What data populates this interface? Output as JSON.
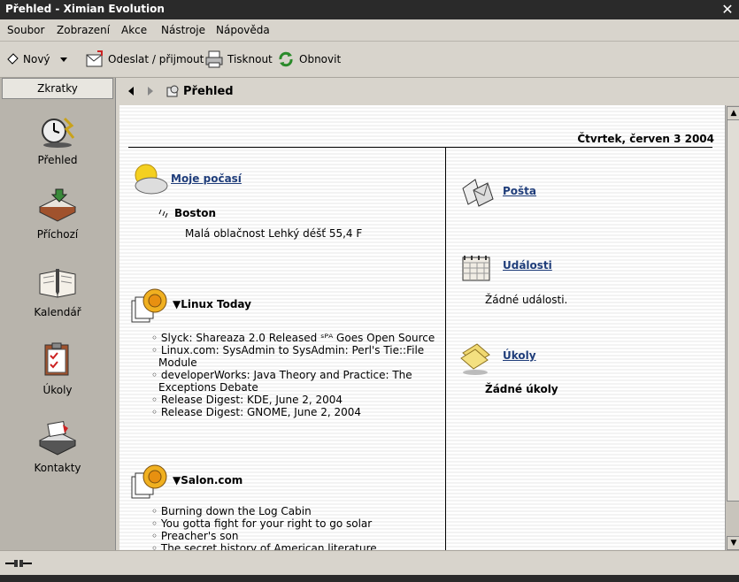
{
  "window": {
    "title": "Přehled - Ximian Evolution"
  },
  "menubar": [
    "Soubor",
    "Zobrazení",
    "Akce",
    "Nástroje",
    "Nápověda"
  ],
  "toolbar": {
    "new": "Nový",
    "send_receive": "Odeslat / přijmout",
    "print": "Tisknout",
    "refresh": "Obnovit"
  },
  "sidebar": {
    "header": "Zkratky",
    "items": [
      {
        "label": "Přehled",
        "icon": "summary-clock-icon"
      },
      {
        "label": "Příchozí",
        "icon": "inbox-tray-icon"
      },
      {
        "label": "Kalendář",
        "icon": "calendar-book-icon"
      },
      {
        "label": "Úkoly",
        "icon": "clipboard-tasks-icon"
      },
      {
        "label": "Kontakty",
        "icon": "contacts-cards-icon"
      }
    ]
  },
  "content": {
    "title": "Přehled",
    "date": "Čtvrtek, červen 3 2004",
    "weather": {
      "title": "Moje počasí",
      "city": "Boston",
      "city_suffix": ":",
      "conditions": "Malá oblačnost Lehký déšť 55,4 F"
    },
    "feeds": [
      {
        "title": "Linux Today",
        "items": [
          "Slyck: Shareaza 2.0 Released ˢᴾᴬ Goes Open Source",
          "Linux.com: SysAdmin to SysAdmin: Perl's Tie::File Module",
          "developerWorks: Java Theory and Practice: The Exceptions Debate",
          "Release Digest: KDE, June 2, 2004",
          "Release Digest: GNOME, June 2, 2004"
        ]
      },
      {
        "title": "Salon.com",
        "items": [
          "Burning down the Log Cabin",
          "You gotta fight for your right to go solar",
          "Preacher's son",
          "The secret history of American literature"
        ]
      }
    ],
    "mail": {
      "title": "Pošta"
    },
    "events": {
      "title": "Události",
      "empty": "Žádné události."
    },
    "tasks": {
      "title": "Úkoly",
      "empty": "Žádné úkoly"
    }
  }
}
